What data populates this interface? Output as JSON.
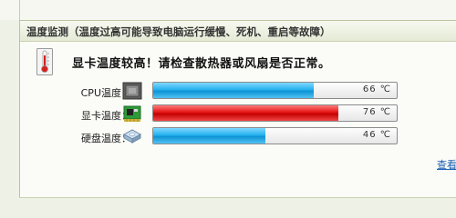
{
  "panel": {
    "title": "温度监测（温度过高可能导致电脑运行缓慢、死机、重启等故障）",
    "alert_text": "显卡温度较高！请检查散热器或风扇是否正常。",
    "link_text": "查看"
  },
  "metrics": [
    {
      "label": "CPU温度：",
      "icon": "cpu-chip-icon",
      "percent": 66,
      "value_text": "66 ℃",
      "status": "normal",
      "color": "#1fa7e6"
    },
    {
      "label": "显卡温度：",
      "icon": "graphics-card-icon",
      "percent": 76,
      "value_text": "76 ℃",
      "status": "high",
      "color": "#dd0f0f"
    },
    {
      "label": "硬盘温度：",
      "icon": "hard-disk-icon",
      "percent": 46,
      "value_text": "46 ℃",
      "status": "normal",
      "color": "#1fa7e6"
    }
  ]
}
